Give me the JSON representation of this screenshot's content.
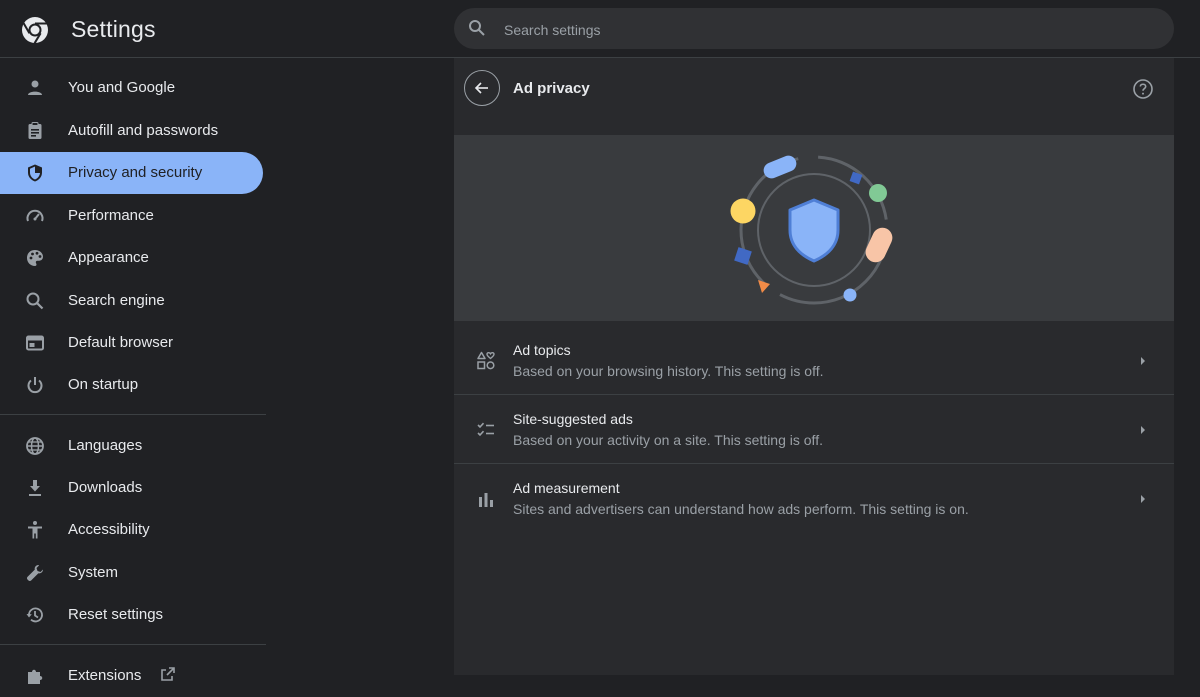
{
  "header": {
    "title": "Settings",
    "search_placeholder": "Search settings"
  },
  "sidebar": {
    "items": [
      {
        "label": "You and Google",
        "icon": "person-icon"
      },
      {
        "label": "Autofill and passwords",
        "icon": "clipboard-icon"
      },
      {
        "label": "Privacy and security",
        "icon": "shield-icon",
        "active": true
      },
      {
        "label": "Performance",
        "icon": "speedometer-icon"
      },
      {
        "label": "Appearance",
        "icon": "palette-icon"
      },
      {
        "label": "Search engine",
        "icon": "search-icon"
      },
      {
        "label": "Default browser",
        "icon": "browser-window-icon"
      },
      {
        "label": "On startup",
        "icon": "power-icon"
      },
      {
        "label": "Languages",
        "icon": "globe-icon"
      },
      {
        "label": "Downloads",
        "icon": "download-icon"
      },
      {
        "label": "Accessibility",
        "icon": "accessibility-icon"
      },
      {
        "label": "System",
        "icon": "wrench-icon"
      },
      {
        "label": "Reset settings",
        "icon": "history-icon"
      },
      {
        "label": "Extensions",
        "icon": "puzzle-icon"
      }
    ]
  },
  "panel": {
    "title": "Ad privacy",
    "rows": [
      {
        "title": "Ad topics",
        "subtitle": "Based on your browsing history. This setting is off.",
        "icon": "topics-icon"
      },
      {
        "title": "Site-suggested ads",
        "subtitle": "Based on your activity on a site. This setting is off.",
        "icon": "checklist-icon"
      },
      {
        "title": "Ad measurement",
        "subtitle": "Sites and advertisers can understand how ads perform. This setting is on.",
        "icon": "bar-chart-icon"
      }
    ]
  },
  "colors": {
    "background": "#202124",
    "panel": "#292a2d",
    "banner": "#393b3e",
    "accent": "#8ab4f8",
    "text": "#e8eaed",
    "subtext": "#9aa0a6"
  }
}
